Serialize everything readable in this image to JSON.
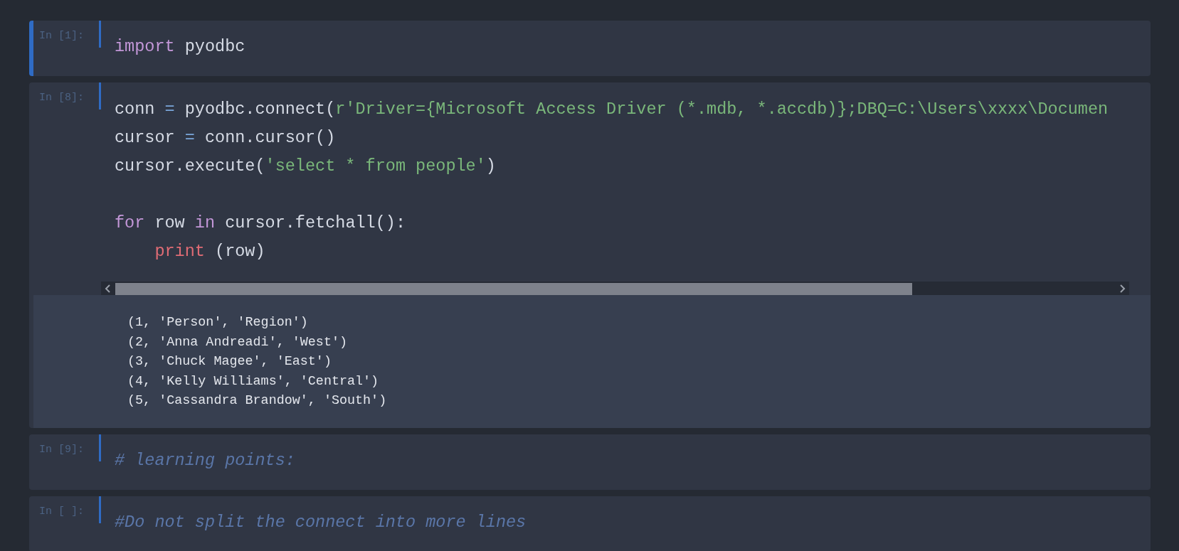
{
  "cells": [
    {
      "prompt": "In [1]:",
      "selected": true,
      "lines": [
        {
          "tokens": [
            {
              "kind": "keyword",
              "text": "import"
            },
            {
              "kind": "plain",
              "text": " pyodbc"
            }
          ]
        }
      ]
    },
    {
      "prompt": "In [8]:",
      "selected": false,
      "scrollbar": true,
      "lines": [
        {
          "tokens": [
            {
              "kind": "plain",
              "text": "conn "
            },
            {
              "kind": "operator",
              "text": "="
            },
            {
              "kind": "plain",
              "text": " pyodbc.connect("
            },
            {
              "kind": "string",
              "text": "r'Driver={Microsoft Access Driver (*.mdb, *.accdb)};DBQ=C:\\Users\\xxxx\\Documen"
            }
          ]
        },
        {
          "tokens": [
            {
              "kind": "plain",
              "text": "cursor "
            },
            {
              "kind": "operator",
              "text": "="
            },
            {
              "kind": "plain",
              "text": " conn.cursor()"
            }
          ]
        },
        {
          "tokens": [
            {
              "kind": "plain",
              "text": "cursor.execute("
            },
            {
              "kind": "string",
              "text": "'select * from people'"
            },
            {
              "kind": "plain",
              "text": ")"
            }
          ]
        },
        {
          "blank": true
        },
        {
          "tokens": [
            {
              "kind": "keyword",
              "text": "for"
            },
            {
              "kind": "plain",
              "text": " row "
            },
            {
              "kind": "keyword",
              "text": "in"
            },
            {
              "kind": "plain",
              "text": " cursor.fetchall():"
            }
          ]
        },
        {
          "tokens": [
            {
              "kind": "builtin",
              "text": "    print"
            },
            {
              "kind": "plain",
              "text": " (row)"
            }
          ]
        }
      ],
      "output": [
        "(1, 'Person', 'Region')",
        "(2, 'Anna Andreadi', 'West')",
        "(3, 'Chuck Magee', 'East')",
        "(4, 'Kelly Williams', 'Central')",
        "(5, 'Cassandra Brandow', 'South')"
      ]
    },
    {
      "prompt": "In [9]:",
      "selected": false,
      "lines": [
        {
          "tokens": [
            {
              "kind": "comment",
              "text": "# learning points:"
            }
          ]
        }
      ]
    },
    {
      "prompt": "In [ ]:",
      "selected": false,
      "lines": [
        {
          "tokens": [
            {
              "kind": "comment",
              "text": "#Do not split the connect into more lines"
            }
          ]
        }
      ]
    }
  ]
}
